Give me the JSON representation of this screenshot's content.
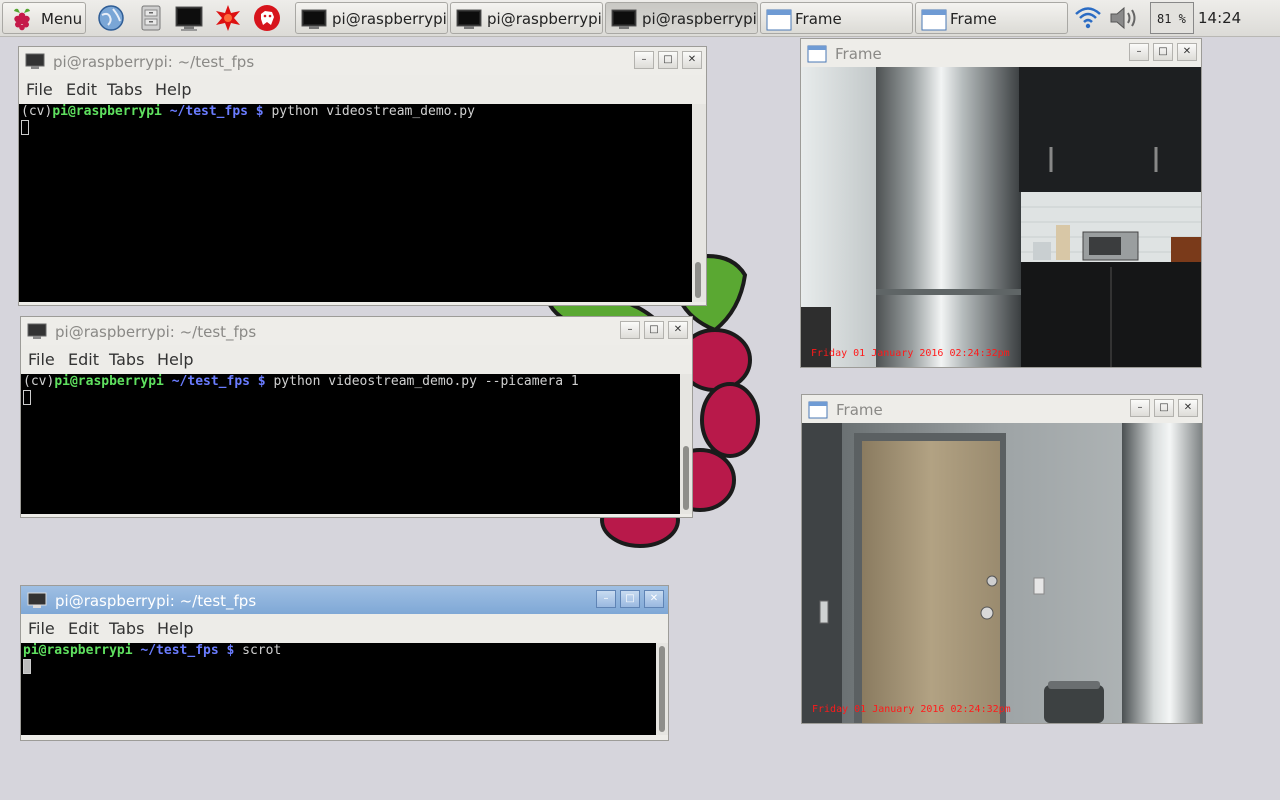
{
  "taskbar": {
    "menu_label": "Menu",
    "launchers": [
      "web-browser-icon",
      "file-manager-icon",
      "terminal-icon",
      "wolfram-icon",
      "mathematica-icon"
    ],
    "tasks": [
      {
        "label": "pi@raspberrypi...",
        "icon": "terminal-icon",
        "active": false
      },
      {
        "label": "pi@raspberrypi...",
        "icon": "terminal-icon",
        "active": false
      },
      {
        "label": "pi@raspberrypi...",
        "icon": "terminal-icon",
        "active": true
      },
      {
        "label": "Frame",
        "icon": "window-icon",
        "active": false
      },
      {
        "label": "Frame",
        "icon": "window-icon",
        "active": false
      }
    ],
    "cpu": "81 %",
    "clock": "14:24"
  },
  "terminals": [
    {
      "title": "pi@raspberrypi: ~/test_fps",
      "menu": [
        "File",
        "Edit",
        "Tabs",
        "Help"
      ],
      "prompt_prefix": "(cv)",
      "user_host": "pi@raspberrypi",
      "path": "~/test_fps $",
      "command": " python videostream_demo.py"
    },
    {
      "title": "pi@raspberrypi: ~/test_fps",
      "menu": [
        "File",
        "Edit",
        "Tabs",
        "Help"
      ],
      "prompt_prefix": "(cv)",
      "user_host": "pi@raspberrypi",
      "path": "~/test_fps $",
      "command": " python videostream_demo.py --picamera 1"
    },
    {
      "title": "pi@raspberrypi: ~/test_fps",
      "menu": [
        "File",
        "Edit",
        "Tabs",
        "Help"
      ],
      "prompt_prefix": "",
      "user_host": "pi@raspberrypi",
      "path": "~/test_fps $",
      "command": " scrot"
    }
  ],
  "frames": [
    {
      "title": "Frame",
      "timestamp": "Friday 01 January 2016 02:24:32pm"
    },
    {
      "title": "Frame",
      "timestamp": "Friday 01 January 2016 02:24:32pm"
    }
  ],
  "colors": {
    "desktop": "#d6d5dc",
    "prompt_user": "#5fe05f",
    "prompt_path": "#6a7cff",
    "timestamp": "#ff1a1a",
    "focused_title": "#8fb4de"
  }
}
